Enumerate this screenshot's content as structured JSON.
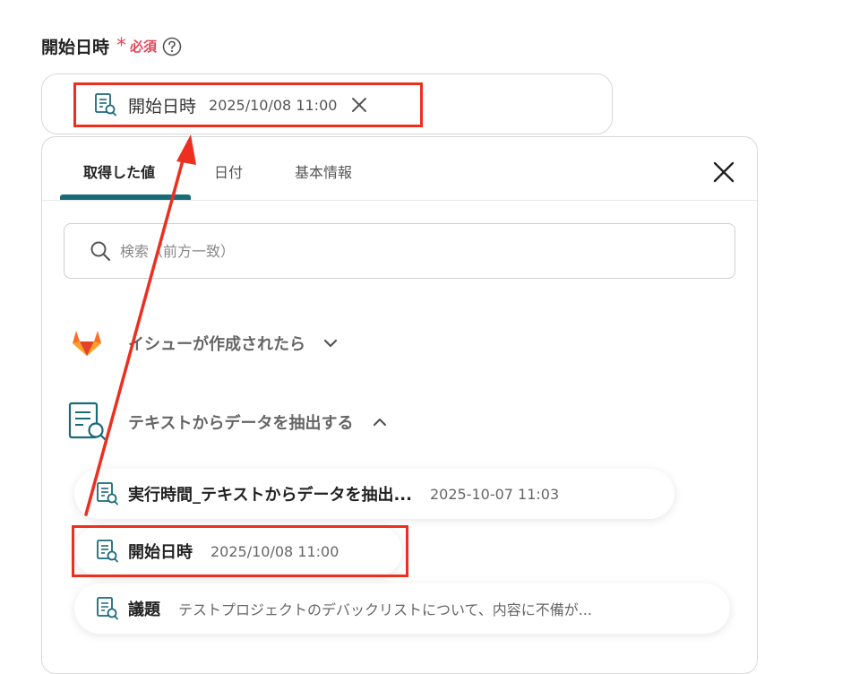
{
  "field": {
    "title": "開始日時",
    "required_mark": "*",
    "required_text": "必須"
  },
  "selected_chip": {
    "label": "開始日時",
    "value": "2025/10/08 11:00"
  },
  "tabs": [
    {
      "label": "取得した値",
      "active": true
    },
    {
      "label": "日付",
      "active": false
    },
    {
      "label": "基本情報",
      "active": false
    }
  ],
  "search": {
    "placeholder": "検索（前方一致）"
  },
  "sections": [
    {
      "label": "イシューが作成されたら",
      "expanded": false,
      "icon": "gitlab-icon"
    },
    {
      "label": "テキストからデータを抽出する",
      "expanded": true,
      "icon": "document-search-icon"
    }
  ],
  "items": [
    {
      "label": "実行時間_テキストからデータを抽出...",
      "value": "2025-10-07 11:03"
    },
    {
      "label": "開始日時",
      "value": "2025/10/08 11:00"
    },
    {
      "label": "議題",
      "value": "テストプロジェクトのデバックリストについて、内容に不備が..."
    }
  ],
  "colors": {
    "accent": "#1a6b7a",
    "required": "#e8445a",
    "annotation": "#ee2e1e"
  }
}
